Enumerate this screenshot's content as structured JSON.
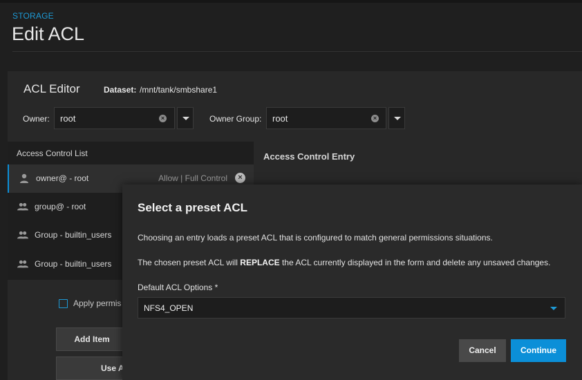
{
  "breadcrumb": "STORAGE",
  "page_title": "Edit ACL",
  "editor": {
    "title": "ACL Editor",
    "dataset_label": "Dataset:",
    "dataset_value": "/mnt/tank/smbshare1",
    "owner_label": "Owner:",
    "owner_value": "root",
    "owner_group_label": "Owner Group:",
    "owner_group_value": "root"
  },
  "acl_list": {
    "header": "Access Control List",
    "items": [
      {
        "label": "owner@ - root",
        "permission": "Allow | Full Control",
        "icon": "person-icon"
      },
      {
        "label": "group@ - root",
        "icon": "group-icon"
      },
      {
        "label": "Group - builtin_users",
        "icon": "group-icon"
      },
      {
        "label": "Group - builtin_users",
        "icon": "group-icon"
      }
    ]
  },
  "entry_panel": {
    "title": "Access Control Entry"
  },
  "controls": {
    "apply_label": "Apply permis",
    "add_item": "Add Item",
    "use_acl": "Use A"
  },
  "dialog": {
    "title": "Select a preset ACL",
    "text1": "Choosing an entry loads a preset ACL that is configured to match general permissions situations.",
    "text2_pre": "The chosen preset ACL will ",
    "text2_bold": "REPLACE",
    "text2_post": " the ACL currently displayed in the form and delete any unsaved changes.",
    "select_label": "Default ACL Options *",
    "select_value": "NFS4_OPEN",
    "cancel": "Cancel",
    "continue": "Continue"
  },
  "colors": {
    "accent": "#0b8fd8",
    "breadcrumb": "#1e9ad6",
    "background": "#1f1f1f",
    "dialog": "#2a2a2a"
  }
}
